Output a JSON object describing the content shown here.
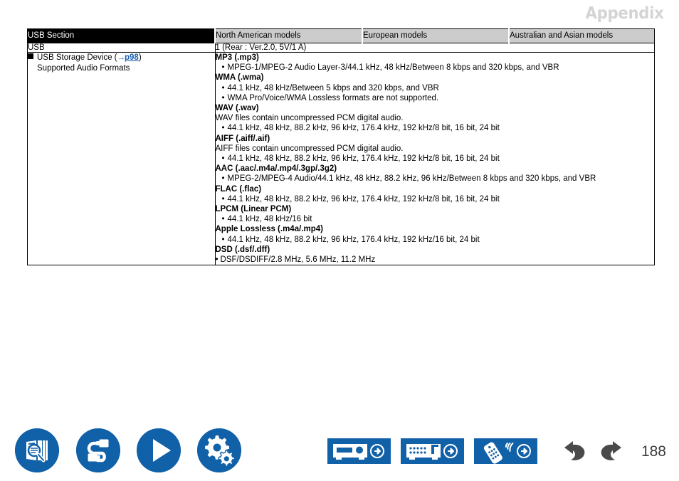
{
  "header": {
    "title": "Appendix"
  },
  "table": {
    "columns": [
      "USB Section",
      "North American models",
      "European models",
      "Australian and Asian models"
    ],
    "rows": [
      {
        "label": "USB",
        "value": "1 (Rear : Ver.2.0, 5V/1 A)"
      }
    ],
    "device_row": {
      "label_line1": "USB Storage Device (",
      "link_arrow": "→",
      "link_text": "p98",
      "label_line1_end": ")",
      "label_line2": "Supported Audio Formats"
    },
    "formats": [
      {
        "kind": "title",
        "text": "MP3 (.mp3)"
      },
      {
        "kind": "bullet",
        "text": "MPEG-1/MPEG-2 Audio Layer-3/44.1 kHz, 48 kHz/Between 8 kbps and 320 kbps, and VBR"
      },
      {
        "kind": "title",
        "text": "WMA (.wma)"
      },
      {
        "kind": "bullet",
        "text": "44.1 kHz, 48 kHz/Between 5 kbps and 320 kbps, and VBR"
      },
      {
        "kind": "bullet",
        "text": "WMA Pro/Voice/WMA Lossless formats are not supported."
      },
      {
        "kind": "title",
        "text": "WAV (.wav)"
      },
      {
        "kind": "plain",
        "text": "WAV files contain uncompressed PCM digital audio."
      },
      {
        "kind": "bullet",
        "text": "44.1 kHz, 48 kHz, 88.2 kHz, 96 kHz, 176.4 kHz, 192 kHz/8 bit, 16 bit, 24 bit"
      },
      {
        "kind": "title",
        "text": "AIFF (.aiff/.aif)"
      },
      {
        "kind": "plain",
        "text": "AIFF files contain uncompressed PCM digital audio."
      },
      {
        "kind": "bullet",
        "text": "44.1 kHz, 48 kHz, 88.2 kHz, 96 kHz, 176.4 kHz, 192 kHz/8 bit, 16 bit, 24 bit"
      },
      {
        "kind": "title",
        "text": "AAC (.aac/.m4a/.mp4/.3gp/.3g2)"
      },
      {
        "kind": "bullet",
        "text": "MPEG-2/MPEG-4 Audio/44.1 kHz, 48 kHz, 88.2 kHz, 96 kHz/Between 8 kbps and 320 kbps, and VBR"
      },
      {
        "kind": "title",
        "text": "FLAC (.flac)"
      },
      {
        "kind": "bullet",
        "text": "44.1 kHz, 48 kHz, 88.2 kHz, 96 kHz, 176.4 kHz, 192 kHz/8 bit, 16 bit, 24 bit"
      },
      {
        "kind": "title",
        "text": "LPCM (Linear PCM)"
      },
      {
        "kind": "bullet",
        "text": "44.1 kHz, 48 kHz/16 bit"
      },
      {
        "kind": "title",
        "text": "Apple Lossless (.m4a/.mp4)"
      },
      {
        "kind": "bullet",
        "text": "44.1 kHz, 48 kHz, 88.2 kHz, 96 kHz, 176.4 kHz, 192 kHz/16 bit, 24 bit"
      },
      {
        "kind": "title",
        "text": "DSD (.dsf/.dff)"
      },
      {
        "kind": "bullet-tight",
        "text": "DSF/DSDIFF/2.8 MHz, 5.6 MHz, 11.2 MHz"
      }
    ]
  },
  "bottom_nav": {
    "circle_buttons": [
      {
        "name": "contents-search-icon",
        "label": "Contents / Search"
      },
      {
        "name": "connections-icon",
        "label": "Connections"
      },
      {
        "name": "playback-icon",
        "label": "Playback"
      },
      {
        "name": "setup-icon",
        "label": "Setup"
      }
    ],
    "panel_buttons": [
      {
        "name": "front-panel-icon",
        "label": "Front Panel"
      },
      {
        "name": "rear-panel-icon",
        "label": "Rear Panel"
      },
      {
        "name": "remote-control-icon",
        "label": "Remote Control"
      }
    ],
    "history_buttons": [
      {
        "name": "back-icon",
        "label": "Back"
      },
      {
        "name": "forward-icon",
        "label": "Forward"
      }
    ],
    "page_number": "188"
  },
  "colors": {
    "brand_blue": "#1161a8",
    "link_blue": "#1a5fb4",
    "header_gray": "#d4d4d4",
    "column_header_gray": "#cccccc",
    "history_gray": "#4a4a4a"
  }
}
